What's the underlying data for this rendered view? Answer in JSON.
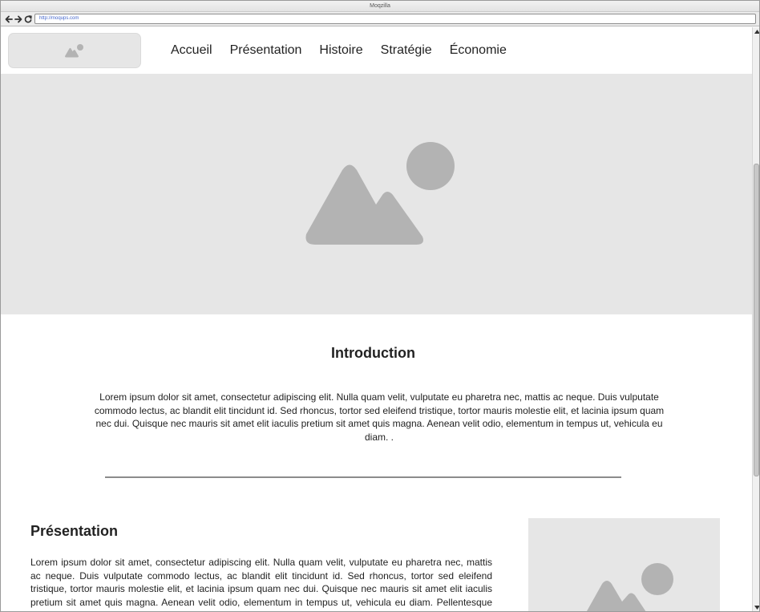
{
  "browser": {
    "title": "Moqzilla",
    "url": "http://moqups.com"
  },
  "site": {
    "nav": [
      {
        "label": "Accueil"
      },
      {
        "label": "Présentation"
      },
      {
        "label": "Histoire"
      },
      {
        "label": "Stratégie"
      },
      {
        "label": "Économie"
      }
    ]
  },
  "intro": {
    "title": "Introduction",
    "text": "Lorem ipsum dolor sit amet, consectetur adipiscing elit. Nulla quam velit, vulputate eu pharetra nec, mattis ac neque. Duis vulputate commodo lectus, ac blandit elit tincidunt id. Sed rhoncus, tortor sed eleifend tristique, tortor mauris molestie elit, et lacinia ipsum quam nec dui. Quisque nec mauris sit amet elit iaculis pretium sit amet quis magna. Aenean velit odio, elementum in tempus ut, vehicula eu diam. ."
  },
  "presentation": {
    "title": "Présentation",
    "text": "Lorem ipsum dolor sit amet, consectetur adipiscing elit. Nulla quam velit, vulputate eu pharetra nec, mattis ac neque. Duis vulputate commodo lectus, ac blandit elit tincidunt id. Sed rhoncus, tortor sed eleifend tristique, tortor mauris molestie elit, et lacinia ipsum quam nec dui. Quisque nec mauris sit amet elit iaculis pretium sit amet quis magna. Aenean velit odio, elementum in tempus ut, vehicula eu diam. Pellentesque rhoncus aliquam mattis. Ut vulputate eros sed felis sodales nec vulputate justo"
  },
  "icons": {
    "back": "arrow-left-icon",
    "forward": "arrow-right-icon",
    "reload": "reload-icon",
    "placeholder": "image-placeholder-icon",
    "scroll_up": "scroll-up-icon",
    "scroll_down": "scroll-down-icon"
  },
  "colors": {
    "placeholder_bg": "#e6e6e6",
    "placeholder_icon": "#b3b3b3",
    "divider": "#8c8c8c",
    "url_text": "#4466cc"
  }
}
